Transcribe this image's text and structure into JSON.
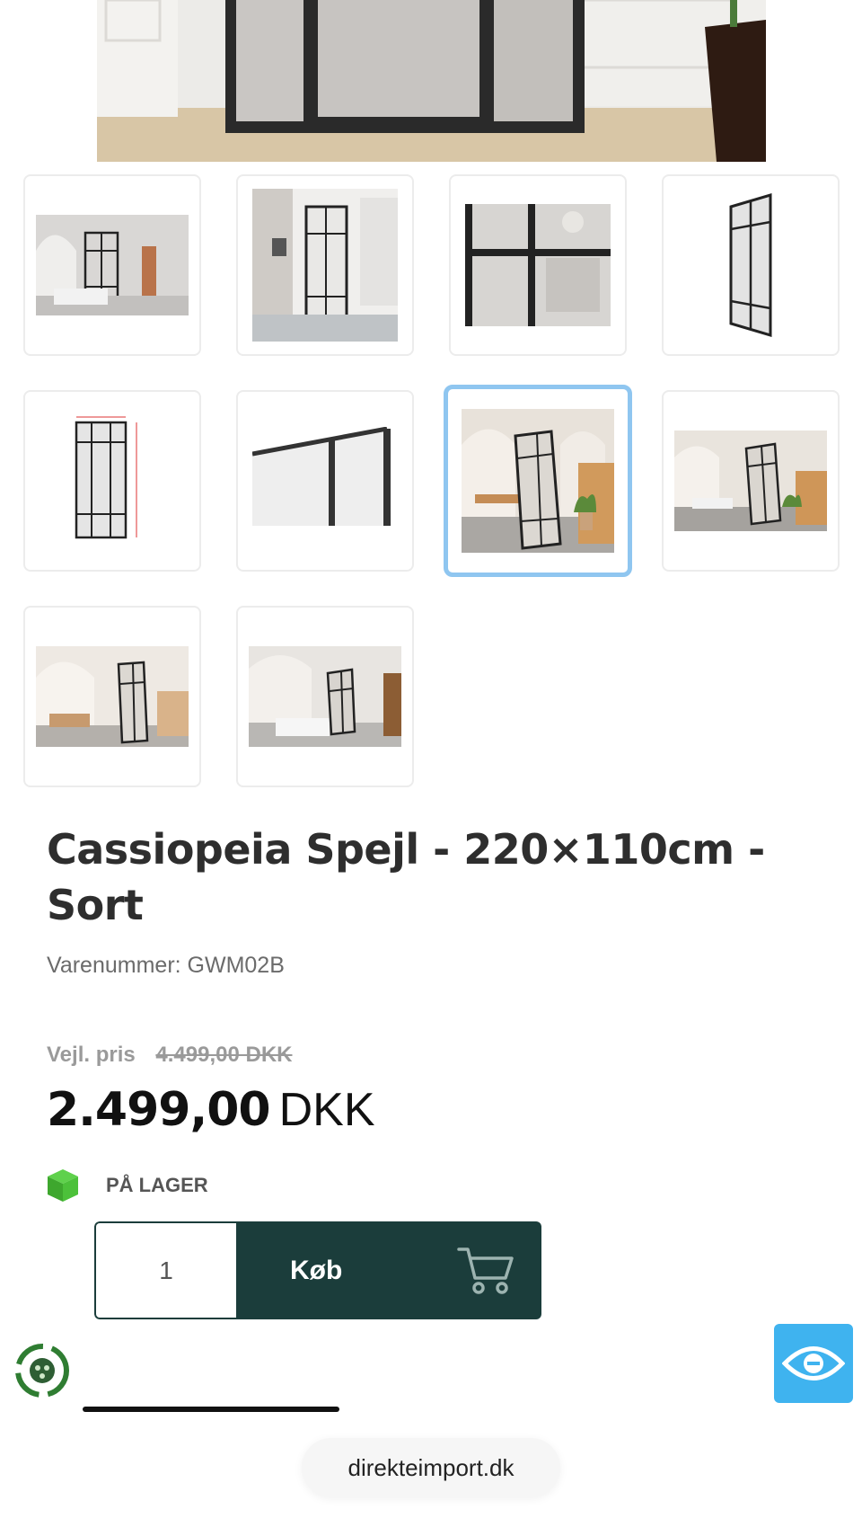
{
  "product": {
    "title": "Cassiopeia Spejl - 220×110cm - Sort",
    "sku": "Varenummer: GWM02B"
  },
  "pricing": {
    "rrp_label": "Vejl. pris",
    "rrp_value": "4.499,00 DKK",
    "price_amount": "2.499,00",
    "price_currency": "DKK"
  },
  "stock": {
    "label": "PÅ LAGER",
    "icon": "green-box-icon",
    "color": "#4cc13a"
  },
  "cart": {
    "quantity": "1",
    "buy_label": "Køb",
    "button_color": "#1b3d3b",
    "icon": "cart-icon"
  },
  "gallery": {
    "thumbnail_count": 10,
    "selected_index": 6,
    "selected_border_color": "#8fc6f0"
  },
  "browser": {
    "url": "direkteimport.dk"
  },
  "floating": {
    "left_icon": "recycle-icon",
    "right_icon": "eye-icon",
    "right_color": "#3fb3ef"
  }
}
